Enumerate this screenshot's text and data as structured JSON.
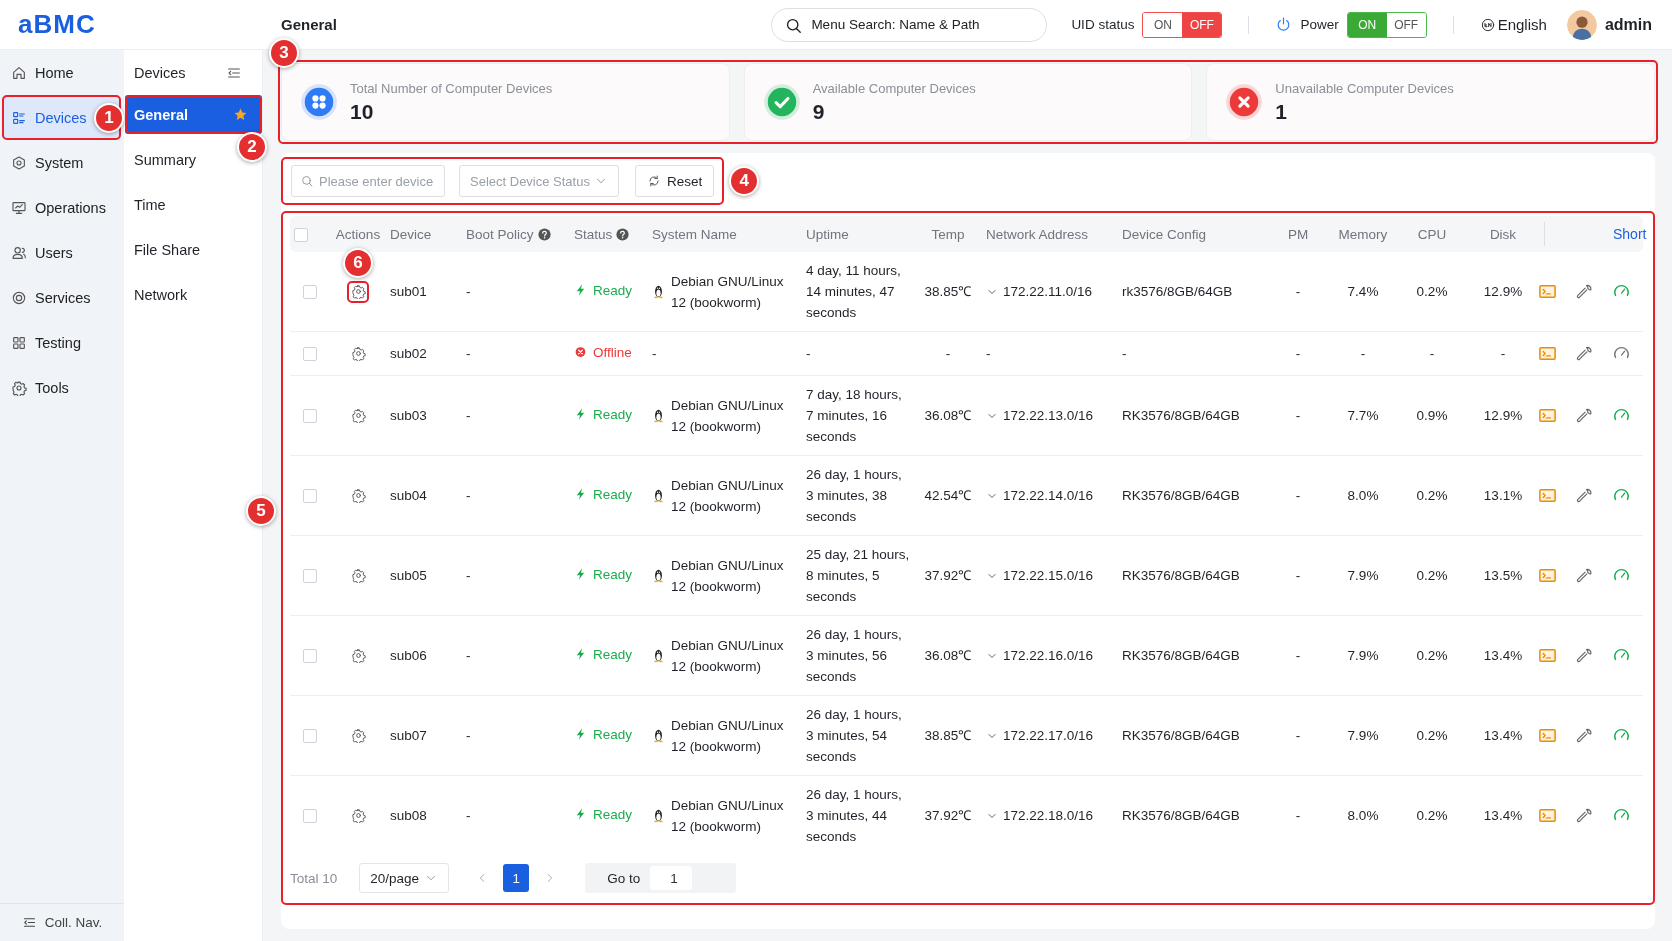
{
  "header": {
    "logo": "aBMC",
    "page_title": "General",
    "search": {
      "placeholder": "Menu Search: Name & Path"
    },
    "uid_status": {
      "label": "UID status",
      "options": [
        {
          "label": "ON",
          "selected": false
        },
        {
          "label": "OFF",
          "selected": true
        }
      ]
    },
    "power": {
      "label": "Power",
      "options": [
        {
          "label": "ON",
          "selected": true
        },
        {
          "label": "OFF",
          "selected": false
        }
      ]
    },
    "language": "English",
    "user": "admin"
  },
  "sidebar": {
    "items": [
      {
        "label": "Home",
        "kind": "home",
        "selected": false
      },
      {
        "label": "Devices",
        "kind": "devices",
        "selected": true
      },
      {
        "label": "System",
        "kind": "system",
        "selected": false
      },
      {
        "label": "Operations",
        "kind": "operations",
        "selected": false
      },
      {
        "label": "Users",
        "kind": "users",
        "selected": false
      },
      {
        "label": "Services",
        "kind": "services",
        "selected": false
      },
      {
        "label": "Testing",
        "kind": "testing",
        "selected": false
      },
      {
        "label": "Tools",
        "kind": "tools",
        "selected": false
      }
    ],
    "collapse_label": "Coll. Nav."
  },
  "subnav": {
    "title": "Devices",
    "items": [
      {
        "label": "General",
        "selected": true,
        "starred": true
      },
      {
        "label": "Summary",
        "selected": false,
        "starred": false
      },
      {
        "label": "Time",
        "selected": false,
        "starred": false
      },
      {
        "label": "File Share",
        "selected": false,
        "starred": false
      },
      {
        "label": "Network",
        "selected": false,
        "starred": false
      }
    ]
  },
  "stats": [
    {
      "kind": "total",
      "label": "Total Number of Computer Devices",
      "value": "10"
    },
    {
      "kind": "available",
      "label": "Available Computer Devices",
      "value": "9"
    },
    {
      "kind": "unavailable",
      "label": "Unavailable Computer Devices",
      "value": "1"
    }
  ],
  "filters": {
    "search": {
      "placeholder": "Please enter device"
    },
    "status_select": {
      "placeholder": "Select Device Status"
    },
    "reset_button": "Reset"
  },
  "table": {
    "select_all": {
      "checked": false
    },
    "columns": [
      {
        "label": "Actions",
        "help": false
      },
      {
        "label": "Device",
        "help": false
      },
      {
        "label": "Boot Policy",
        "help": true
      },
      {
        "label": "Status",
        "help": true
      },
      {
        "label": "System Name",
        "help": false
      },
      {
        "label": "Uptime",
        "help": false
      },
      {
        "label": "Temp",
        "help": false
      },
      {
        "label": "Network Address",
        "help": false
      },
      {
        "label": "Device Config",
        "help": false
      },
      {
        "label": "PM",
        "help": false
      },
      {
        "label": "Memory",
        "help": false
      },
      {
        "label": "CPU",
        "help": false
      },
      {
        "label": "Disk",
        "help": false
      }
    ],
    "short_link": "Short",
    "rows": [
      {
        "checked": false,
        "device": "sub01",
        "boot_policy": "-",
        "status": {
          "kind": "ready",
          "label": "Ready"
        },
        "os_icon": true,
        "system_name": "Debian GNU/Linux 12 (bookworm)",
        "uptime": "4 day, 11 hours, 14 minutes, 47 seconds",
        "temp": "38.85℃",
        "network": {
          "address": "172.22.11.0/16",
          "expandable": true
        },
        "config": "rk3576/8GB/64GB",
        "pm": "-",
        "memory": "7.4%",
        "cpu": "0.2%",
        "disk": "12.9%"
      },
      {
        "checked": false,
        "device": "sub02",
        "boot_policy": "-",
        "status": {
          "kind": "offline",
          "label": "Offline"
        },
        "os_icon": false,
        "system_name": "-",
        "uptime": "-",
        "temp": "-",
        "network": {
          "address": "-",
          "expandable": false
        },
        "config": "-",
        "pm": "-",
        "memory": "-",
        "cpu": "-",
        "disk": "-"
      },
      {
        "checked": false,
        "device": "sub03",
        "boot_policy": "-",
        "status": {
          "kind": "ready",
          "label": "Ready"
        },
        "os_icon": true,
        "system_name": "Debian GNU/Linux 12 (bookworm)",
        "uptime": "7 day, 18 hours, 7 minutes, 16 seconds",
        "temp": "36.08℃",
        "network": {
          "address": "172.22.13.0/16",
          "expandable": true
        },
        "config": "RK3576/8GB/64GB",
        "pm": "-",
        "memory": "7.7%",
        "cpu": "0.9%",
        "disk": "12.9%"
      },
      {
        "checked": false,
        "device": "sub04",
        "boot_policy": "-",
        "status": {
          "kind": "ready",
          "label": "Ready"
        },
        "os_icon": true,
        "system_name": "Debian GNU/Linux 12 (bookworm)",
        "uptime": "26 day, 1 hours, 3 minutes, 38 seconds",
        "temp": "42.54℃",
        "network": {
          "address": "172.22.14.0/16",
          "expandable": true
        },
        "config": "RK3576/8GB/64GB",
        "pm": "-",
        "memory": "8.0%",
        "cpu": "0.2%",
        "disk": "13.1%"
      },
      {
        "checked": false,
        "device": "sub05",
        "boot_policy": "-",
        "status": {
          "kind": "ready",
          "label": "Ready"
        },
        "os_icon": true,
        "system_name": "Debian GNU/Linux 12 (bookworm)",
        "uptime": "25 day, 21 hours, 8 minutes, 5 seconds",
        "temp": "37.92℃",
        "network": {
          "address": "172.22.15.0/16",
          "expandable": true
        },
        "config": "RK3576/8GB/64GB",
        "pm": "-",
        "memory": "7.9%",
        "cpu": "0.2%",
        "disk": "13.5%"
      },
      {
        "checked": false,
        "device": "sub06",
        "boot_policy": "-",
        "status": {
          "kind": "ready",
          "label": "Ready"
        },
        "os_icon": true,
        "system_name": "Debian GNU/Linux 12 (bookworm)",
        "uptime": "26 day, 1 hours, 3 minutes, 56 seconds",
        "temp": "36.08℃",
        "network": {
          "address": "172.22.16.0/16",
          "expandable": true
        },
        "config": "RK3576/8GB/64GB",
        "pm": "-",
        "memory": "7.9%",
        "cpu": "0.2%",
        "disk": "13.4%"
      },
      {
        "checked": false,
        "device": "sub07",
        "boot_policy": "-",
        "status": {
          "kind": "ready",
          "label": "Ready"
        },
        "os_icon": true,
        "system_name": "Debian GNU/Linux 12 (bookworm)",
        "uptime": "26 day, 1 hours, 3 minutes, 54 seconds",
        "temp": "38.85℃",
        "network": {
          "address": "172.22.17.0/16",
          "expandable": true
        },
        "config": "RK3576/8GB/64GB",
        "pm": "-",
        "memory": "7.9%",
        "cpu": "0.2%",
        "disk": "13.4%"
      },
      {
        "checked": false,
        "device": "sub08",
        "boot_policy": "-",
        "status": {
          "kind": "ready",
          "label": "Ready"
        },
        "os_icon": true,
        "system_name": "Debian GNU/Linux 12 (bookworm)",
        "uptime": "26 day, 1 hours, 3 minutes, 44 seconds",
        "temp": "37.92℃",
        "network": {
          "address": "172.22.18.0/16",
          "expandable": true
        },
        "config": "RK3576/8GB/64GB",
        "pm": "-",
        "memory": "8.0%",
        "cpu": "0.2%",
        "disk": "13.4%"
      }
    ]
  },
  "pagination": {
    "total": "Total 10",
    "page_size": "20/page",
    "pages": [
      {
        "label": "1",
        "selected": true
      }
    ],
    "goto_label": "Go to",
    "goto_value": "1"
  },
  "callouts": [
    {
      "label": "1"
    },
    {
      "label": "2"
    },
    {
      "label": "3"
    },
    {
      "label": "4"
    },
    {
      "label": "5"
    },
    {
      "label": "6"
    }
  ]
}
